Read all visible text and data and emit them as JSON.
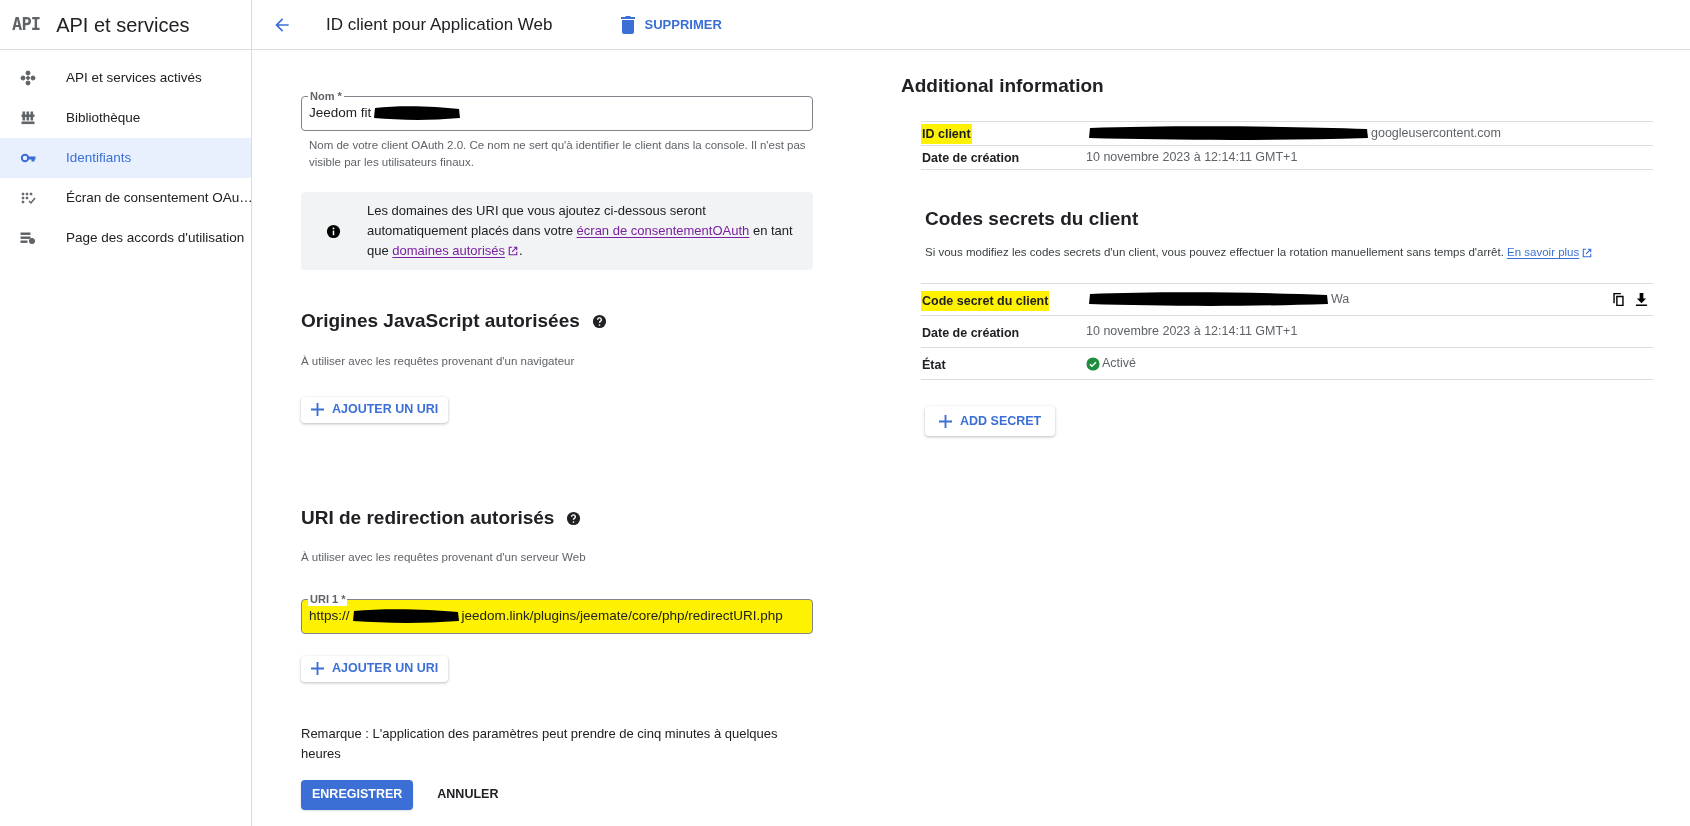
{
  "sidebar": {
    "logo": "API",
    "title": "API et services",
    "items": [
      {
        "label": "API et services activés",
        "selected": false
      },
      {
        "label": "Bibliothèque",
        "selected": false
      },
      {
        "label": "Identifiants",
        "selected": true
      },
      {
        "label": "Écran de consentement OAu…",
        "selected": false
      },
      {
        "label": "Page des accords d'utilisation",
        "selected": false
      }
    ]
  },
  "header": {
    "title": "ID client pour Application Web",
    "delete_button": "SUPPRIMER"
  },
  "form": {
    "name_field": {
      "label": "Nom *",
      "value_start": "Jeedom fit",
      "redacted": true
    },
    "name_hint": "Nom de votre client OAuth 2.0. Ce nom ne sert qu'à identifier le client dans la console. Il n'est pas visible par les utilisateurs finaux.",
    "notice": [
      {
        "kind": "text",
        "text": "Les domaines des URI que vous ajoutez ci-dessous seront automatiquement placés dans votre "
      },
      {
        "kind": "link",
        "text": "écran de consentementOAuth",
        "external": false
      },
      {
        "kind": "text",
        "text": " en tant que "
      },
      {
        "kind": "link",
        "text": "domaines autorisés",
        "external": true
      },
      {
        "kind": "text",
        "text": "."
      }
    ],
    "js_origins": {
      "title": "Origines JavaScript autorisées",
      "subtitle": "À utiliser avec les requêtes provenant d'un navigateur",
      "add_button": "AJOUTER UN URI"
    },
    "redirect_uris": {
      "title": "URI de redirection autorisés",
      "subtitle": "À utiliser avec les requêtes provenant d'un serveur Web",
      "add_button": "AJOUTER UN URI",
      "uris": [
        {
          "label": "URI 1 *",
          "value_start": "https://",
          "redacted": true,
          "value_end": "jeedom.link/plugins/jeemate/core/php/redirectURI.php",
          "highlighted": true
        }
      ]
    },
    "note": "Remarque : L'application des paramètres peut prendre de cinq minutes à quelques heures",
    "save_button": "ENREGISTRER",
    "cancel_button": "ANNULER"
  },
  "additional_info": {
    "title": "Additional information",
    "rows": [
      {
        "kind": "text",
        "label": "ID client",
        "highlighted": true,
        "redacted": true,
        "value": "googleusercontent.com"
      },
      {
        "kind": "text",
        "label": "Date de création",
        "highlighted": false,
        "redacted": false,
        "value": "10 novembre 2023 à 12:14:11 GMT+1"
      }
    ]
  },
  "secrets": {
    "title": "Codes secrets du client",
    "description": "Si vous modifiez les codes secrets d'un client, vous pouvez effectuer la rotation manuellement sans temps d'arrêt.",
    "learn_more": "En savoir plus",
    "rows": [
      {
        "kind": "secret",
        "label": "Code secret du client",
        "highlighted": true,
        "redacted": true,
        "value": "Wa"
      },
      {
        "kind": "text",
        "label": "Date de création",
        "highlighted": false,
        "redacted": false,
        "value": "10 novembre 2023 à 12:14:11 GMT+1"
      },
      {
        "kind": "status",
        "label": "État",
        "highlighted": false,
        "redacted": false,
        "value": "Activé"
      }
    ],
    "add_button": "ADD SECRET"
  }
}
